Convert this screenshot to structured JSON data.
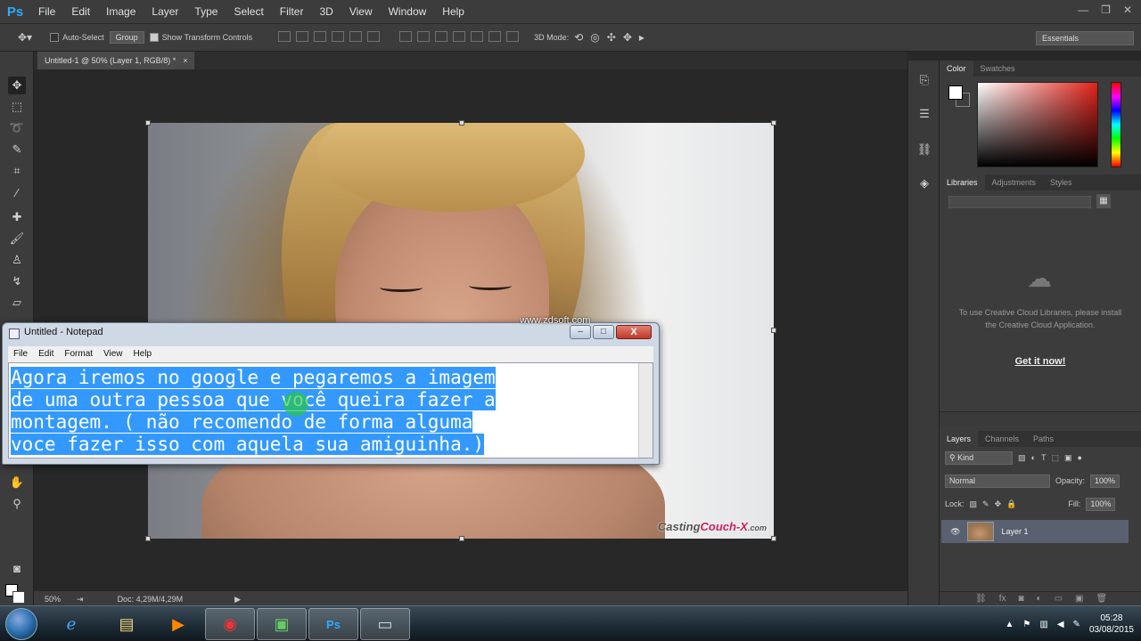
{
  "app": {
    "logo": "Ps"
  },
  "menubar": {
    "items": [
      "File",
      "Edit",
      "Image",
      "Layer",
      "Type",
      "Select",
      "Filter",
      "3D",
      "View",
      "Window",
      "Help"
    ],
    "min": "—",
    "restore": "❐",
    "close": "✕"
  },
  "options": {
    "auto_select": "Auto-Select",
    "group": "Group",
    "show_transform": "Show Transform Controls",
    "mode_3d": "3D Mode:",
    "workspace": "Essentials"
  },
  "document": {
    "tab_title": "Untitled-1 @ 50% (Layer 1, RGB/8) *",
    "tab_close": "×"
  },
  "status": {
    "zoom": "50%",
    "doc_size": "Doc: 4,29M/4,29M"
  },
  "photo": {
    "watermark_a": "Casting",
    "watermark_b": "Couch-X",
    "watermark_c": ".com",
    "overlay_url": "www.zdsoft.com"
  },
  "panels": {
    "color_tabs": [
      "Color",
      "Swatches"
    ],
    "library_tabs": [
      "Libraries",
      "Adjustments",
      "Styles"
    ],
    "library_message": "To use Creative Cloud Libraries, please install the Creative Cloud Application.",
    "get_it_now": "Get it now!",
    "layers_tabs": [
      "Layers",
      "Channels",
      "Paths"
    ],
    "kind_filter": "Kind",
    "blend_mode": "Normal",
    "opacity_label": "Opacity:",
    "opacity_value": "100%",
    "lock_label": "Lock:",
    "fill_label": "Fill:",
    "fill_value": "100%",
    "layer_name": "Layer 1"
  },
  "notepad": {
    "title": "Untitled - Notepad",
    "min": "–",
    "max": "□",
    "close": "X",
    "menu": [
      "File",
      "Edit",
      "Format",
      "View",
      "Help"
    ],
    "lines": [
      "Agora iremos no google e pegaremos a imagem",
      "de uma outra pessoa que você queira fazer a",
      "montagem. ( não recomendo de forma alguma",
      "voce fazer isso com aquela sua amiguinha.)"
    ]
  },
  "taskbar": {
    "time": "05:28",
    "date": "03/08/2015"
  },
  "colors": {
    "accent": "#31a8ff",
    "selection": "#3399ff",
    "layer_selected": "#596070"
  }
}
